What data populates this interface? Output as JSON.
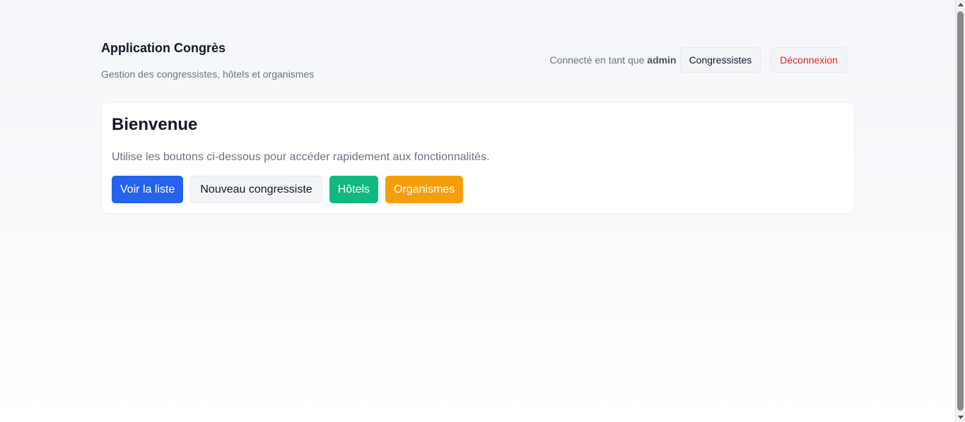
{
  "header": {
    "title": "Application Congrès",
    "subtitle": "Gestion des congressistes, hôtels et organismes",
    "connected_prefix": "Connecté en tant que",
    "username": "admin",
    "nav_congressistes": "Congressistes",
    "logout": "Déconnexion"
  },
  "main": {
    "title": "Bienvenue",
    "description": "Utilise les boutons ci-dessous pour accéder rapidement aux fonctionnalités.",
    "buttons": {
      "list": "Voir la liste",
      "new": "Nouveau congressiste",
      "hotels": "Hôtels",
      "organisms": "Organismes"
    }
  },
  "colors": {
    "primary": "#2563eb",
    "success": "#10b981",
    "warning": "#f59e0b",
    "danger": "#dc2626"
  },
  "icons": {
    "scroll_up": "scroll-up-arrow-icon",
    "scroll_down": "scroll-down-arrow-icon"
  }
}
